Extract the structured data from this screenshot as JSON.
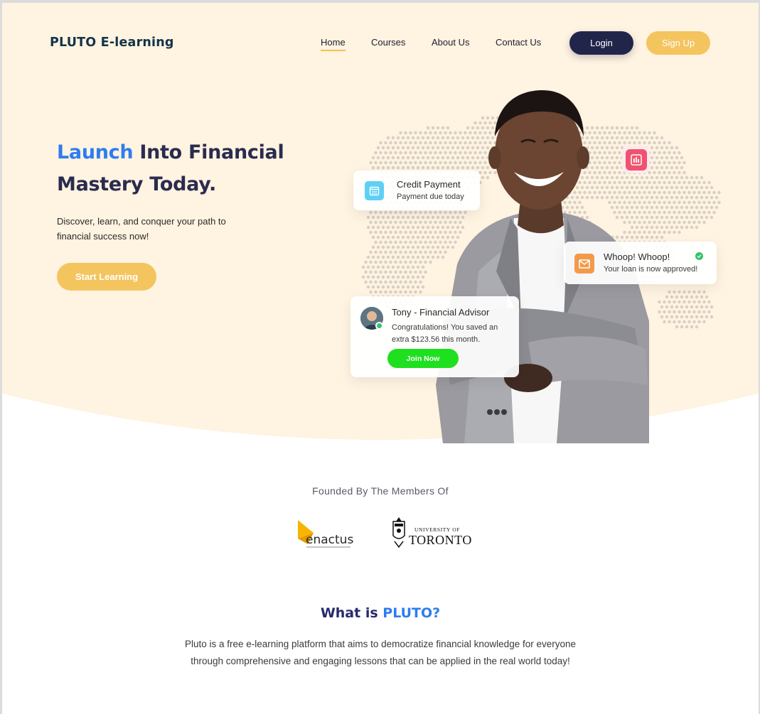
{
  "header": {
    "brand": "PLUTO E-learning",
    "nav": [
      "Home",
      "Courses",
      "About Us",
      "Contact Us"
    ],
    "login_label": "Login",
    "signup_label": "Sign Up"
  },
  "hero": {
    "title_accent": "Launch",
    "title_rest": " Into Financial Mastery Today.",
    "subtitle": "Discover, learn, and conquer your path to financial success now!",
    "cta_label": "Start Learning"
  },
  "cards": {
    "credit": {
      "title": "Credit Payment",
      "subtitle": "Payment due today",
      "icon": "calendar-icon"
    },
    "whoop": {
      "title": "Whoop! Whoop!",
      "subtitle": "Your loan is now approved!",
      "icon": "mail-icon"
    },
    "tony": {
      "title": "Tony - Financial Advisor",
      "message": "Congratulations! You saved an extra $123.56 this month.",
      "button_label": "Join Now"
    },
    "chart_badge_icon": "bar-chart-icon"
  },
  "founded": {
    "heading": "Founded By The Members Of",
    "logos": [
      "enactus",
      "UNIVERSITY OF TORONTO"
    ],
    "enactus_name": "enactus",
    "uoft_top": "UNIVERSITY OF",
    "uoft_bottom": "TORONTO"
  },
  "about": {
    "title_prefix": "What is ",
    "title_accent": "PLUTO?",
    "body": "Pluto is a free e-learning platform that aims to democratize financial knowledge for everyone through comprehensive and engaging lessons that can be applied in the real world today!"
  },
  "colors": {
    "hero_bg": "#fff3e1",
    "accent_blue": "#2d7df0",
    "navy": "#22254a",
    "yellow": "#f4c45e",
    "green": "#1fe01f"
  }
}
